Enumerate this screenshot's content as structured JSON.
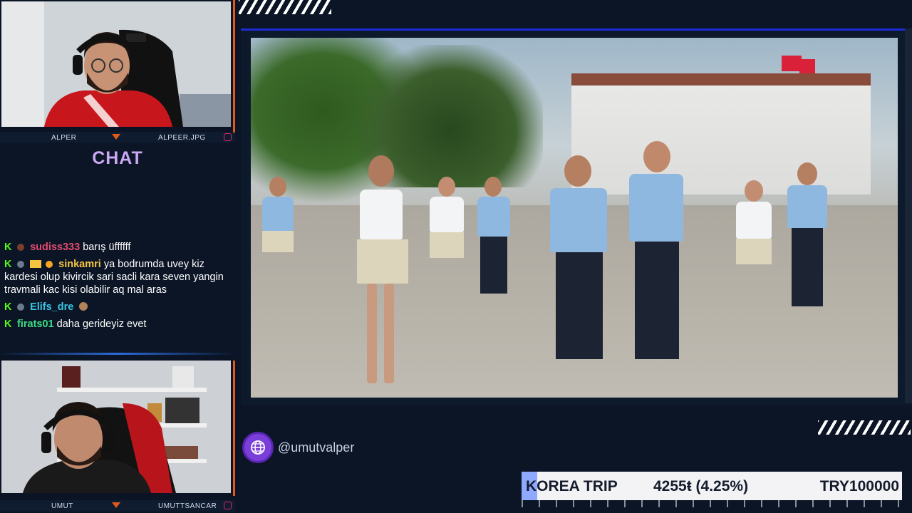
{
  "webcam_top": {
    "left_name": "ALPER",
    "right_name": "ALPEER.JPG"
  },
  "webcam_bottom": {
    "left_name": "UMUT",
    "right_name": "UMUTTSANCAR"
  },
  "chat": {
    "title": "CHAT",
    "messages": [
      {
        "username": "sudiss333",
        "text": "barış üffffff",
        "user_color": "#e34a6f"
      },
      {
        "username": "sinkamri",
        "text": "ya bodrumda uvey kiz kardesi olup kivircik sari sacli kara seven yangin travmali kac kisi olabilir aq mal aras",
        "user_color": "#f5c542"
      },
      {
        "username": "Elifs_dre",
        "text": "",
        "user_color": "#3ac4e2"
      },
      {
        "username": "firats01",
        "text": "daha gerideyiz evet",
        "user_color": "#3ddc84"
      }
    ]
  },
  "social": {
    "handle": "@umutvalper",
    "icon": "globe-icon"
  },
  "ticker": {
    "label": "KOREA TRIP",
    "progress": "4255ŧ (4.25%)",
    "goal": "TRY100000",
    "progress_fraction": 0.0425
  },
  "colors": {
    "accent_orange": "#e15a17",
    "chat_title": "#c9a7f2",
    "brand_purple": "#7b3fd9",
    "kick_green": "#53fc18"
  }
}
